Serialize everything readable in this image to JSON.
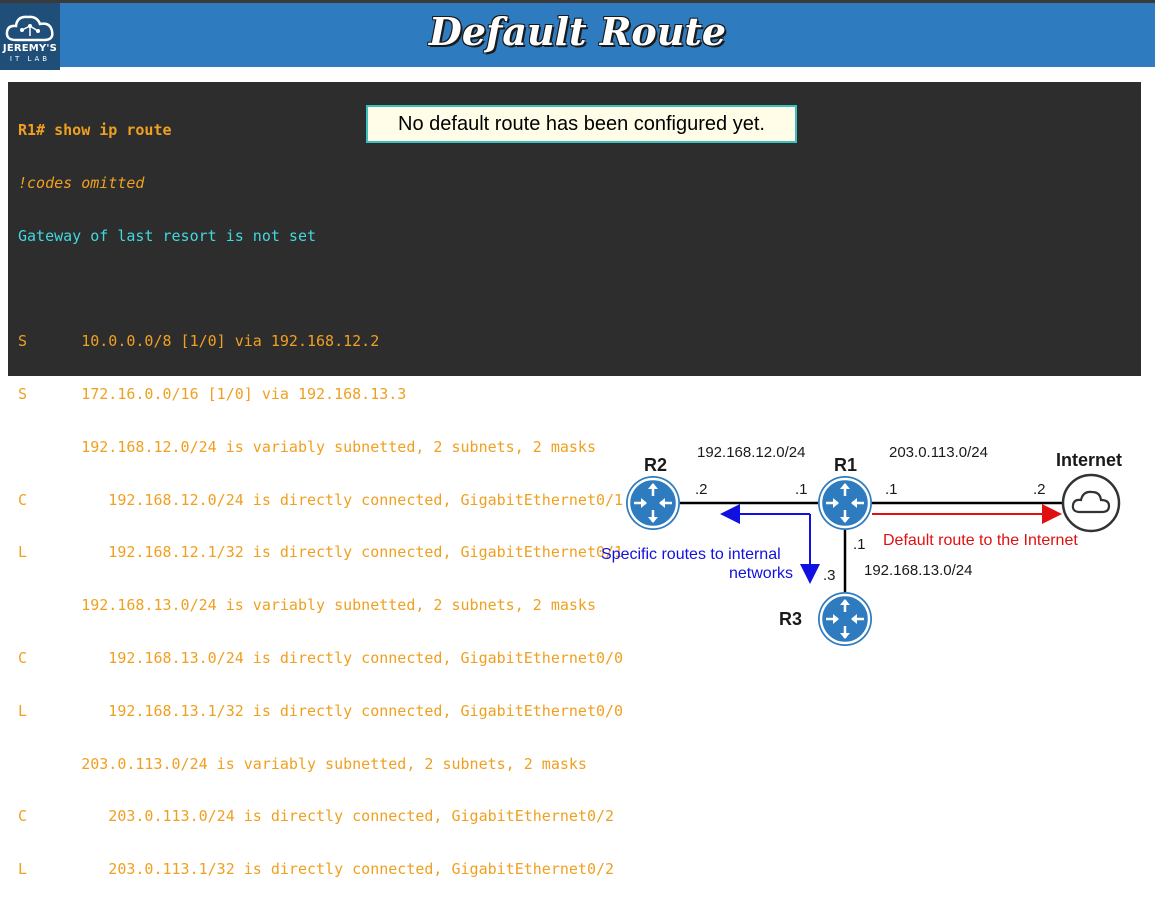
{
  "header": {
    "title": "Default Route",
    "logo_line1": "JEREMY'S",
    "logo_line2": "IT LAB"
  },
  "terminal": {
    "prompt": "R1# show ip route",
    "comment": "!codes omitted",
    "gateway": "Gateway of last resort is not set",
    "blank": " ",
    "lines": [
      "S      10.0.0.0/8 [1/0] via 192.168.12.2",
      "S      172.16.0.0/16 [1/0] via 192.168.13.3",
      "       192.168.12.0/24 is variably subnetted, 2 subnets, 2 masks",
      "C         192.168.12.0/24 is directly connected, GigabitEthernet0/1",
      "L         192.168.12.1/32 is directly connected, GigabitEthernet0/1",
      "       192.168.13.0/24 is variably subnetted, 2 subnets, 2 masks",
      "C         192.168.13.0/24 is directly connected, GigabitEthernet0/0",
      "L         192.168.13.1/32 is directly connected, GigabitEthernet0/0",
      "       203.0.113.0/24 is variably subnetted, 2 subnets, 2 masks",
      "C         203.0.113.0/24 is directly connected, GigabitEthernet0/2",
      "L         203.0.113.1/32 is directly connected, GigabitEthernet0/2"
    ]
  },
  "callout": "No default route has been configured yet.",
  "diagram": {
    "r1": "R1",
    "r2": "R2",
    "r3": "R3",
    "internet": "Internet",
    "net_r1_r2": "192.168.12.0/24",
    "net_r1_inet": "203.0.113.0/24",
    "net_r1_r3": "192.168.13.0/24",
    "r2_if": ".2",
    "r1_if_left": ".1",
    "r1_if_right": ".1",
    "inet_if": ".2",
    "r1_if_down": ".1",
    "r3_if": ".3",
    "specific_line1": "Specific routes to internal",
    "specific_line2": "networks",
    "default_label": "Default route to the Internet",
    "colors": {
      "specific": "#1010e0",
      "default": "#e01010",
      "router": "#2f7bbf"
    }
  }
}
